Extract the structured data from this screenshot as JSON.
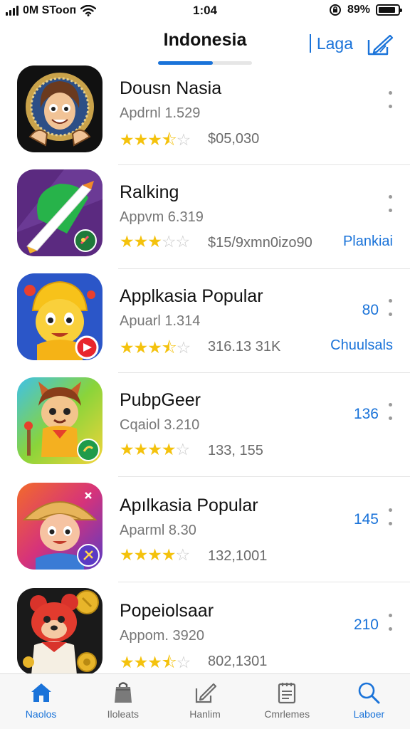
{
  "status_bar": {
    "carrier": "0M STooп",
    "time": "1:04",
    "battery": "89%",
    "battery_level": 0.89
  },
  "header": {
    "title": "Indonesia",
    "link": "Laga",
    "tab_progress": 0.58
  },
  "apps": [
    {
      "name": "Dousn Nasia",
      "subtitle": "Apdrnl 1.529",
      "rating": 3.5,
      "meta": "$05,030",
      "action": "",
      "count": "",
      "icon": "portrait-gold-icon"
    },
    {
      "name": "Ralking",
      "subtitle": "Appvm 6.319",
      "rating": 3,
      "meta": "$15/9xmn0izo90",
      "action": "Plankiai",
      "count": "",
      "icon": "brush-green-icon"
    },
    {
      "name": "Applkasia Popular",
      "subtitle": "Apuarl 1.314",
      "rating": 3.5,
      "meta": "316.13 31K",
      "action": "Chuulsals",
      "count": "80",
      "icon": "yellow-hero-icon"
    },
    {
      "name": "PubpGeer",
      "subtitle": "Cqaiol 3.210",
      "rating": 4,
      "meta": "133, 155",
      "action": "",
      "count": "136",
      "icon": "fox-kid-icon"
    },
    {
      "name": "Apılkasia Popular",
      "subtitle": "Aparml 8.30",
      "rating": 4,
      "meta": "132,1001",
      "action": "",
      "count": "145",
      "icon": "farmer-boy-icon"
    },
    {
      "name": "Popeiolsaar",
      "subtitle": "Appom. 3920",
      "rating": 3.5,
      "meta": "802,1301",
      "action": "",
      "count": "210",
      "icon": "red-bear-icon"
    }
  ],
  "tab_bar": [
    {
      "label": "Naolos",
      "icon": "home-icon",
      "active": true
    },
    {
      "label": "Iloleats",
      "icon": "bag-icon",
      "active": false
    },
    {
      "label": "Hanlim",
      "icon": "edit-box-icon",
      "active": false
    },
    {
      "label": "Cmrlemes",
      "icon": "clipboard-icon",
      "active": false
    },
    {
      "label": "Laboer",
      "icon": "search-icon",
      "active": true
    }
  ],
  "colors": {
    "accent": "#1a73d9",
    "star": "#f4c20d",
    "star_off": "#c9c9c9"
  }
}
